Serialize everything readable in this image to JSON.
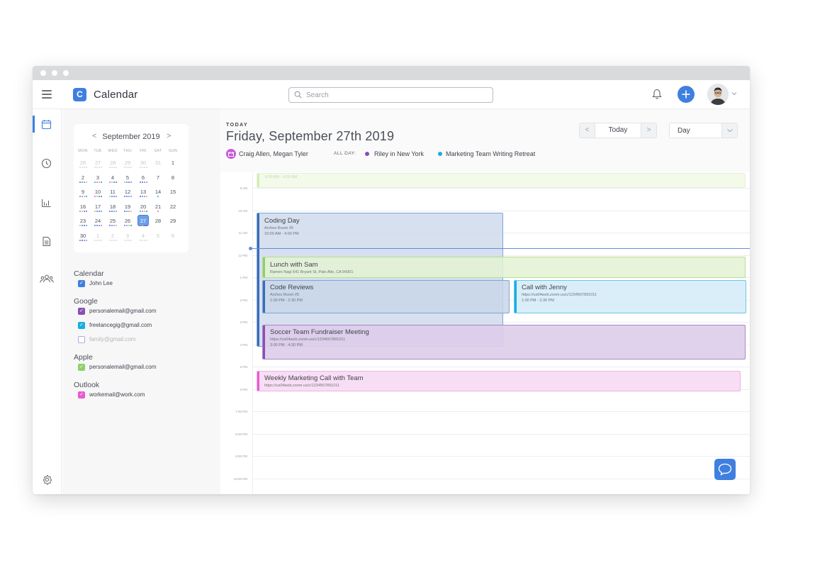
{
  "app": {
    "name": "Calendar",
    "logo_letter": "C"
  },
  "search": {
    "placeholder": "Search"
  },
  "colors": {
    "accent": "#3f7fe0",
    "purple": "#8a4fb6",
    "cyan": "#18aee0",
    "green": "#8fd06a",
    "pink": "#e85ad2"
  },
  "mini_calendar": {
    "month_label": "September 2019",
    "prev": "<",
    "next": ">",
    "weekdays": [
      "MON",
      "TUE",
      "WED",
      "THU",
      "FRI",
      "SAT",
      "SUN"
    ],
    "weeks": [
      [
        "26",
        "27",
        "28",
        "29",
        "30",
        "31",
        "1"
      ],
      [
        "2",
        "3",
        "4",
        "5",
        "6",
        "7",
        "8"
      ],
      [
        "9",
        "10",
        "11",
        "12",
        "13",
        "14",
        "15"
      ],
      [
        "16",
        "17",
        "18",
        "19",
        "20",
        "21",
        "22"
      ],
      [
        "23",
        "24",
        "25",
        "26",
        "27",
        "28",
        "29"
      ],
      [
        "30",
        "1",
        "2",
        "3",
        "4",
        "5",
        "6"
      ]
    ],
    "selected": "27"
  },
  "sources": [
    {
      "heading": "Calendar",
      "items": [
        {
          "label": "John Lee",
          "color": "#3f7fe0",
          "checked": true
        }
      ]
    },
    {
      "heading": "Google",
      "items": [
        {
          "label": "personalemail@gmail.com",
          "color": "#8a4fb6",
          "checked": true
        },
        {
          "label": "freelancegig@gmail.com",
          "color": "#18aee0",
          "checked": true
        },
        {
          "label": "family@gmail.com",
          "color": "#b9a8d8",
          "checked": false
        }
      ]
    },
    {
      "heading": "Apple",
      "items": [
        {
          "label": "personalemail@gmail.com",
          "color": "#8fd06a",
          "checked": true
        }
      ]
    },
    {
      "heading": "Outlook",
      "items": [
        {
          "label": "workemail@work.com",
          "color": "#e85ad2",
          "checked": true
        }
      ]
    }
  ],
  "header": {
    "today_label": "TODAY",
    "date_title": "Friday, September 27th 2019",
    "nav_prev": "<",
    "nav_today": "Today",
    "nav_next": ">",
    "view_label": "Day",
    "people": "Craig Allen,  Megan Tyler",
    "allday_label": "ALL DAY:",
    "allday_events": [
      "Riley in New York",
      "Marketing Team Writing Retreat"
    ]
  },
  "time_labels": [
    "9 AM",
    "10 AM",
    "11 AM",
    "12 PM",
    "1 PM",
    "2 PM",
    "3 PM",
    "4 PM",
    "5 PM",
    "6 PM",
    "7:00 PM",
    "8:00 PM",
    "9:00 PM",
    "10:00 PM"
  ],
  "events": {
    "early": {
      "time": "8:00 AM - 9:00 AM"
    },
    "coding_day": {
      "title": "Coding Day",
      "location": "Arches Room #5",
      "time": "10:00 AM - 4:00 PM"
    },
    "lunch": {
      "title": "Lunch with Sam",
      "location": "Ramen Nagi 541 Bryant St, Palo Alto, CA 94301"
    },
    "code_reviews": {
      "title": "Code Reviews",
      "location": "Arches Room #5",
      "time": "1:00 PM - 2:30 PM"
    },
    "call_jenny": {
      "title": "Call with Jenny",
      "location": "https://us04web.zoom.us/c/1234567891011",
      "time": "1:00 PM - 2:30 PM"
    },
    "fundraiser": {
      "title": "Soccer Team Fundraiser Meeting",
      "location": "https://us04web.zoom.us/c/1234567891011",
      "time": "3:00 PM - 4:30 PM"
    },
    "weekly_call": {
      "title": "Weekly Marketing Call with Team",
      "location": "https://us04web.zoom.us/c/1234567891011"
    }
  }
}
